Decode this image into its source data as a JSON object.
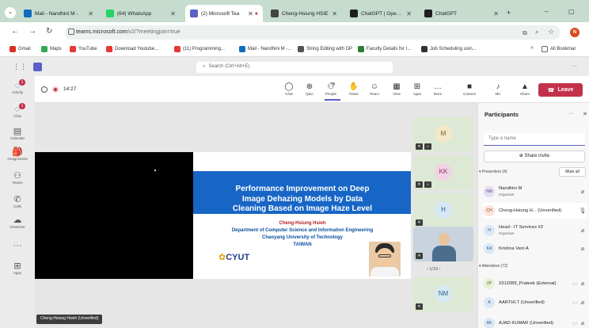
{
  "browser": {
    "tabs": [
      {
        "title": "Mail - Nandhini M -",
        "color": "#0f6cbd",
        "active": false
      },
      {
        "title": "(64) WhatsApp",
        "color": "#25d366",
        "active": false
      },
      {
        "title": "(2) Microsoft Tea",
        "color": "#5b5fc7",
        "active": true
      },
      {
        "title": "Cheng-Hsiung HSIE",
        "color": "#444444",
        "active": false
      },
      {
        "title": "ChatGPT | OpenAI",
        "color": "#1f1f1f",
        "active": false
      },
      {
        "title": "ChatGPT",
        "color": "#1f1f1f",
        "active": false
      }
    ],
    "url_host": "teams.microsoft.com",
    "url_path": "/v2/?meetingjoin=true",
    "bookmarks": [
      {
        "label": "Gmail",
        "color": "#d93025"
      },
      {
        "label": "Maps",
        "color": "#34a853"
      },
      {
        "label": "YouTube",
        "color": "#e53935"
      },
      {
        "label": "Download Youtube...",
        "color": "#e53935"
      },
      {
        "label": "(11) Programming...",
        "color": "#e53935"
      },
      {
        "label": "Mail - Nandhini M -...",
        "color": "#0f6cbd"
      },
      {
        "label": "String Editing with DP",
        "color": "#555555"
      },
      {
        "label": "Faculty Details for I...",
        "color": "#2e7d32"
      },
      {
        "label": "Job Scheduling usin...",
        "color": "#333333"
      }
    ],
    "all_bookmarks": "All Bookmar"
  },
  "teams": {
    "search_placeholder": "Search (Ctrl+Alt+E)",
    "rail": [
      {
        "label": "Activity",
        "icon": "bell-icon",
        "badge": "1"
      },
      {
        "label": "Chat",
        "icon": "chat-icon",
        "badge": "1"
      },
      {
        "label": "Calendar",
        "icon": "calendar-icon",
        "badge": ""
      },
      {
        "label": "Assignments",
        "icon": "assignments-icon",
        "badge": ""
      },
      {
        "label": "Teams",
        "icon": "teams-icon",
        "badge": ""
      },
      {
        "label": "Calls",
        "icon": "phone-icon",
        "badge": ""
      },
      {
        "label": "OneDrive",
        "icon": "cloud-icon",
        "badge": ""
      },
      {
        "label": "",
        "icon": "more-icon",
        "badge": ""
      },
      {
        "label": "Apps",
        "icon": "apps-icon",
        "badge": ""
      }
    ]
  },
  "meeting": {
    "time": "14:27",
    "people_count": "76",
    "toolbar": [
      {
        "label": "Chat",
        "glyph": "◯"
      },
      {
        "label": "Q&A",
        "glyph": "⊕"
      },
      {
        "label": "People",
        "glyph": "⚇"
      },
      {
        "label": "Raise",
        "glyph": "✋"
      },
      {
        "label": "React",
        "glyph": "☺"
      },
      {
        "label": "View",
        "glyph": "▦"
      },
      {
        "label": "Apps",
        "glyph": "⊞"
      },
      {
        "label": "More",
        "glyph": "…"
      },
      {
        "label": "Camera",
        "glyph": "■"
      },
      {
        "label": "Mic",
        "glyph": "♪"
      },
      {
        "label": "Share",
        "glyph": "▲"
      }
    ],
    "leave_label": "Leave",
    "slide": {
      "title_lines": [
        "Performance Improvement on Deep",
        "Image Dehazing Models by Data",
        "Cleaning Based on Image Haze Level"
      ],
      "author": "Cheng-Hsiung Hsieh",
      "dept": "Department of Computer Science and Information Engineering",
      "univ": "Chaoyang University of Technology",
      "country": "TAIWAN",
      "logo": "CYUT"
    },
    "presenter_chip": "Cheng-Hsiung Hsieh (Unverified)",
    "tiles": [
      {
        "initials": "M",
        "bg": "#dde9d4",
        "av": "#f3e8c8",
        "fg": "#6b5a2b"
      },
      {
        "initials": "KK",
        "bg": "#dde9d4",
        "av": "#f0d4e4",
        "fg": "#8b2d5f"
      },
      {
        "initials": "H",
        "bg": "#dde9d4",
        "av": "#d6e8f5",
        "fg": "#2c5d87"
      },
      {
        "initials": "",
        "bg": "#cfd8e2",
        "av": "",
        "fg": ""
      },
      {
        "initials": "NM",
        "bg": "#dde9d4",
        "av": "#d9e9f2",
        "fg": "#2c5d87"
      }
    ],
    "pager": "1/19"
  },
  "participants": {
    "title": "Participants",
    "search_placeholder": "Type a name",
    "share_invite": "Share invite",
    "presenters_label": "Presenters (4)",
    "mute_all": "Mute all",
    "presenters": [
      {
        "initials": "NM",
        "name": "Nandhini M",
        "role": "Organiser",
        "av": "#e5def0",
        "fg": "#5b4a86"
      },
      {
        "initials": "CH",
        "name": "Cheng-Hsiung H... (Unverified)",
        "role": "",
        "av": "#fde3d9",
        "fg": "#9a3b1f"
      },
      {
        "initials": "H",
        "name": "Head - IT Services #2",
        "role": "Organiser",
        "av": "#dbe8f6",
        "fg": "#2c5d87"
      },
      {
        "initials": "KA",
        "name": "Krishna Veni A",
        "role": "",
        "av": "#dbe8f6",
        "fg": "#2c5d87"
      }
    ],
    "attendees_label": "Attendees (72)",
    "attendees": [
      {
        "initials": "2P",
        "name": "2312089_Prateek (External)",
        "av": "#e9f0d7",
        "fg": "#4d6b18"
      },
      {
        "initials": "A",
        "name": "AARTHI.T (Unverified)",
        "av": "#dbe8f6",
        "fg": "#2c5d87"
      },
      {
        "initials": "AK",
        "name": "AJAD KUMAR (Unverified)",
        "av": "#dbe8f6",
        "fg": "#2c5d87"
      }
    ]
  }
}
